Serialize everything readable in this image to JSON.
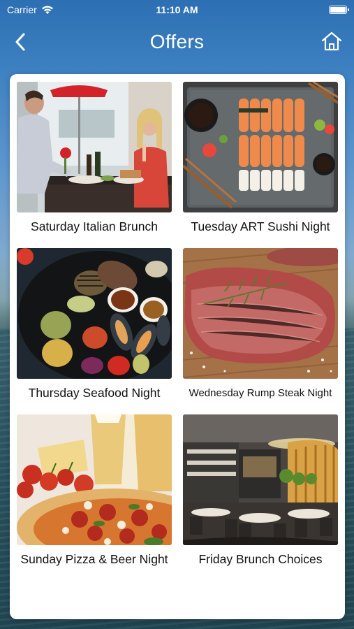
{
  "status": {
    "carrier": "Carrier",
    "time": "11:10 AM"
  },
  "nav": {
    "title": "Offers",
    "back_icon": "chevron-left-icon",
    "home_icon": "home-icon"
  },
  "offers": [
    {
      "title": "Saturday Italian Brunch",
      "image": "couple-dining-photo"
    },
    {
      "title": "Tuesday ART Sushi Night",
      "image": "sushi-platter-photo"
    },
    {
      "title": "Thursday Seafood Night",
      "image": "grilled-seafood-photo"
    },
    {
      "title": "Wednesday Rump Steak Night",
      "image": "steak-photo"
    },
    {
      "title": "Sunday Pizza & Beer Night",
      "image": "pizza-beer-photo"
    },
    {
      "title": "Friday Brunch Choices",
      "image": "restaurant-interior-photo"
    }
  ]
}
